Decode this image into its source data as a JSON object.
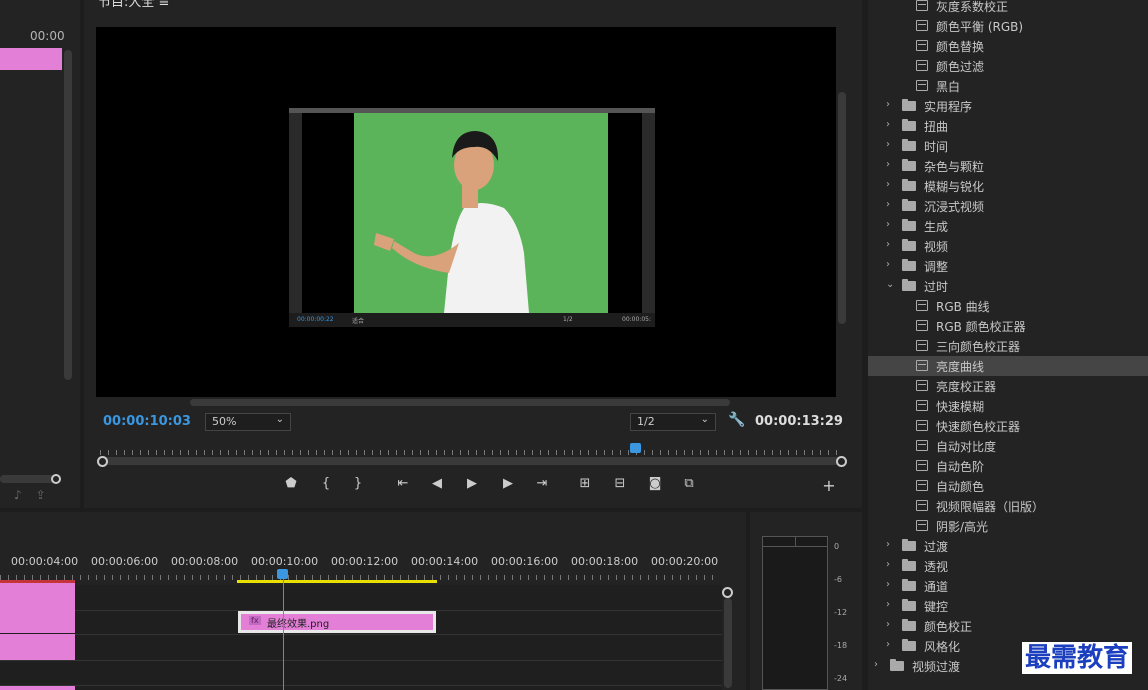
{
  "left_panel": {
    "timecode": "00:00"
  },
  "monitor": {
    "title": "节目:大全 ≡",
    "timecode_current": "00:00:10:03",
    "zoom": "50%",
    "resolution": "1/2",
    "timecode_duration": "00:00:13:29",
    "nested": {
      "timecode": "00:00:00:22",
      "fit": "适合",
      "res": "1/2",
      "duration": "00:00:05:"
    }
  },
  "timeline": {
    "times": [
      "00:00:04:00",
      "00:00:06:00",
      "00:00:08:00",
      "00:00:10:00",
      "00:00:12:00",
      "00:00:14:00",
      "00:00:16:00",
      "00:00:18:00",
      "00:00:20:00"
    ],
    "clip_label": "最终效果.png",
    "clip_fx": "fx"
  },
  "meter": {
    "labels": [
      "0",
      "-6",
      "-12",
      "-18",
      "-24"
    ]
  },
  "effects": {
    "items": [
      {
        "label": "灰度系数校正",
        "type": "fx",
        "level": 2
      },
      {
        "label": "颜色平衡 (RGB)",
        "type": "fx",
        "level": 2
      },
      {
        "label": "颜色替换",
        "type": "fx",
        "level": 2
      },
      {
        "label": "颜色过滤",
        "type": "fx",
        "level": 2
      },
      {
        "label": "黑白",
        "type": "fx",
        "level": 2
      },
      {
        "label": "实用程序",
        "type": "folder",
        "level": 1
      },
      {
        "label": "扭曲",
        "type": "folder",
        "level": 1
      },
      {
        "label": "时间",
        "type": "folder",
        "level": 1
      },
      {
        "label": "杂色与颗粒",
        "type": "folder",
        "level": 1
      },
      {
        "label": "模糊与锐化",
        "type": "folder",
        "level": 1
      },
      {
        "label": "沉浸式视频",
        "type": "folder",
        "level": 1
      },
      {
        "label": "生成",
        "type": "folder",
        "level": 1
      },
      {
        "label": "视频",
        "type": "folder",
        "level": 1
      },
      {
        "label": "调整",
        "type": "folder",
        "level": 1
      },
      {
        "label": "过时",
        "type": "folder-open",
        "level": 1
      },
      {
        "label": "RGB 曲线",
        "type": "fx",
        "level": 2
      },
      {
        "label": "RGB 颜色校正器",
        "type": "fx",
        "level": 2
      },
      {
        "label": "三向颜色校正器",
        "type": "fx",
        "level": 2
      },
      {
        "label": "亮度曲线",
        "type": "fx",
        "level": 2,
        "selected": true
      },
      {
        "label": "亮度校正器",
        "type": "fx",
        "level": 2
      },
      {
        "label": "快速模糊",
        "type": "fx",
        "level": 2
      },
      {
        "label": "快速颜色校正器",
        "type": "fx",
        "level": 2
      },
      {
        "label": "自动对比度",
        "type": "fx",
        "level": 2
      },
      {
        "label": "自动色阶",
        "type": "fx",
        "level": 2
      },
      {
        "label": "自动颜色",
        "type": "fx",
        "level": 2
      },
      {
        "label": "视频限幅器（旧版）",
        "type": "fx",
        "level": 2
      },
      {
        "label": "阴影/高光",
        "type": "fx",
        "level": 2
      },
      {
        "label": "过渡",
        "type": "folder",
        "level": 1
      },
      {
        "label": "透视",
        "type": "folder",
        "level": 1
      },
      {
        "label": "通道",
        "type": "folder",
        "level": 1
      },
      {
        "label": "键控",
        "type": "folder",
        "level": 1
      },
      {
        "label": "颜色校正",
        "type": "folder",
        "level": 1
      },
      {
        "label": "风格化",
        "type": "folder",
        "level": 1
      },
      {
        "label": "视频过渡",
        "type": "folder",
        "level": 0
      }
    ]
  },
  "watermark": "最需教育"
}
